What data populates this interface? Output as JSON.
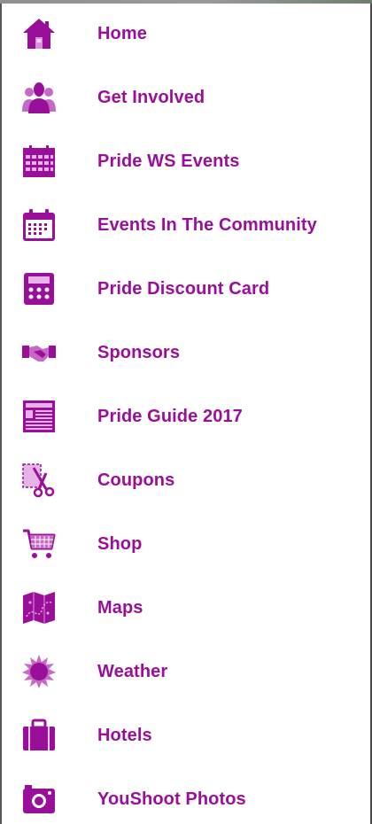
{
  "theme": {
    "accent": "#9a0f9a",
    "background": "#ffffff"
  },
  "menu": {
    "items": [
      {
        "label": "Home",
        "icon": "home-icon"
      },
      {
        "label": "Get Involved",
        "icon": "people-icon"
      },
      {
        "label": "Pride WS Events",
        "icon": "calendar-grid-icon"
      },
      {
        "label": "Events In The Community",
        "icon": "calendar-icon"
      },
      {
        "label": "Pride Discount Card",
        "icon": "calculator-icon"
      },
      {
        "label": "Sponsors",
        "icon": "handshake-icon"
      },
      {
        "label": "Pride Guide 2017",
        "icon": "newspaper-icon"
      },
      {
        "label": "Coupons",
        "icon": "scissors-coupon-icon"
      },
      {
        "label": "Shop",
        "icon": "shopping-cart-icon"
      },
      {
        "label": "Maps",
        "icon": "map-icon"
      },
      {
        "label": "Weather",
        "icon": "sun-icon"
      },
      {
        "label": "Hotels",
        "icon": "suitcase-icon"
      },
      {
        "label": "YouShoot Photos",
        "icon": "camera-icon"
      }
    ]
  }
}
